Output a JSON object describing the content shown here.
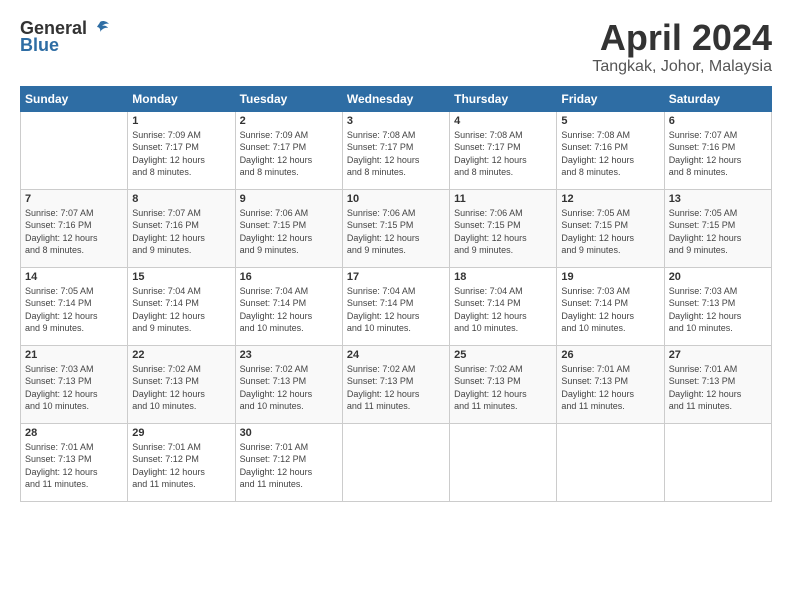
{
  "header": {
    "logo_general": "General",
    "logo_blue": "Blue",
    "title": "April 2024",
    "location": "Tangkak, Johor, Malaysia"
  },
  "calendar": {
    "days_of_week": [
      "Sunday",
      "Monday",
      "Tuesday",
      "Wednesday",
      "Thursday",
      "Friday",
      "Saturday"
    ],
    "weeks": [
      [
        {
          "day": "",
          "info": ""
        },
        {
          "day": "1",
          "info": "Sunrise: 7:09 AM\nSunset: 7:17 PM\nDaylight: 12 hours\nand 8 minutes."
        },
        {
          "day": "2",
          "info": "Sunrise: 7:09 AM\nSunset: 7:17 PM\nDaylight: 12 hours\nand 8 minutes."
        },
        {
          "day": "3",
          "info": "Sunrise: 7:08 AM\nSunset: 7:17 PM\nDaylight: 12 hours\nand 8 minutes."
        },
        {
          "day": "4",
          "info": "Sunrise: 7:08 AM\nSunset: 7:17 PM\nDaylight: 12 hours\nand 8 minutes."
        },
        {
          "day": "5",
          "info": "Sunrise: 7:08 AM\nSunset: 7:16 PM\nDaylight: 12 hours\nand 8 minutes."
        },
        {
          "day": "6",
          "info": "Sunrise: 7:07 AM\nSunset: 7:16 PM\nDaylight: 12 hours\nand 8 minutes."
        }
      ],
      [
        {
          "day": "7",
          "info": "Sunrise: 7:07 AM\nSunset: 7:16 PM\nDaylight: 12 hours\nand 8 minutes."
        },
        {
          "day": "8",
          "info": "Sunrise: 7:07 AM\nSunset: 7:16 PM\nDaylight: 12 hours\nand 9 minutes."
        },
        {
          "day": "9",
          "info": "Sunrise: 7:06 AM\nSunset: 7:15 PM\nDaylight: 12 hours\nand 9 minutes."
        },
        {
          "day": "10",
          "info": "Sunrise: 7:06 AM\nSunset: 7:15 PM\nDaylight: 12 hours\nand 9 minutes."
        },
        {
          "day": "11",
          "info": "Sunrise: 7:06 AM\nSunset: 7:15 PM\nDaylight: 12 hours\nand 9 minutes."
        },
        {
          "day": "12",
          "info": "Sunrise: 7:05 AM\nSunset: 7:15 PM\nDaylight: 12 hours\nand 9 minutes."
        },
        {
          "day": "13",
          "info": "Sunrise: 7:05 AM\nSunset: 7:15 PM\nDaylight: 12 hours\nand 9 minutes."
        }
      ],
      [
        {
          "day": "14",
          "info": "Sunrise: 7:05 AM\nSunset: 7:14 PM\nDaylight: 12 hours\nand 9 minutes."
        },
        {
          "day": "15",
          "info": "Sunrise: 7:04 AM\nSunset: 7:14 PM\nDaylight: 12 hours\nand 9 minutes."
        },
        {
          "day": "16",
          "info": "Sunrise: 7:04 AM\nSunset: 7:14 PM\nDaylight: 12 hours\nand 10 minutes."
        },
        {
          "day": "17",
          "info": "Sunrise: 7:04 AM\nSunset: 7:14 PM\nDaylight: 12 hours\nand 10 minutes."
        },
        {
          "day": "18",
          "info": "Sunrise: 7:04 AM\nSunset: 7:14 PM\nDaylight: 12 hours\nand 10 minutes."
        },
        {
          "day": "19",
          "info": "Sunrise: 7:03 AM\nSunset: 7:14 PM\nDaylight: 12 hours\nand 10 minutes."
        },
        {
          "day": "20",
          "info": "Sunrise: 7:03 AM\nSunset: 7:13 PM\nDaylight: 12 hours\nand 10 minutes."
        }
      ],
      [
        {
          "day": "21",
          "info": "Sunrise: 7:03 AM\nSunset: 7:13 PM\nDaylight: 12 hours\nand 10 minutes."
        },
        {
          "day": "22",
          "info": "Sunrise: 7:02 AM\nSunset: 7:13 PM\nDaylight: 12 hours\nand 10 minutes."
        },
        {
          "day": "23",
          "info": "Sunrise: 7:02 AM\nSunset: 7:13 PM\nDaylight: 12 hours\nand 10 minutes."
        },
        {
          "day": "24",
          "info": "Sunrise: 7:02 AM\nSunset: 7:13 PM\nDaylight: 12 hours\nand 11 minutes."
        },
        {
          "day": "25",
          "info": "Sunrise: 7:02 AM\nSunset: 7:13 PM\nDaylight: 12 hours\nand 11 minutes."
        },
        {
          "day": "26",
          "info": "Sunrise: 7:01 AM\nSunset: 7:13 PM\nDaylight: 12 hours\nand 11 minutes."
        },
        {
          "day": "27",
          "info": "Sunrise: 7:01 AM\nSunset: 7:13 PM\nDaylight: 12 hours\nand 11 minutes."
        }
      ],
      [
        {
          "day": "28",
          "info": "Sunrise: 7:01 AM\nSunset: 7:13 PM\nDaylight: 12 hours\nand 11 minutes."
        },
        {
          "day": "29",
          "info": "Sunrise: 7:01 AM\nSunset: 7:12 PM\nDaylight: 12 hours\nand 11 minutes."
        },
        {
          "day": "30",
          "info": "Sunrise: 7:01 AM\nSunset: 7:12 PM\nDaylight: 12 hours\nand 11 minutes."
        },
        {
          "day": "",
          "info": ""
        },
        {
          "day": "",
          "info": ""
        },
        {
          "day": "",
          "info": ""
        },
        {
          "day": "",
          "info": ""
        }
      ]
    ]
  }
}
